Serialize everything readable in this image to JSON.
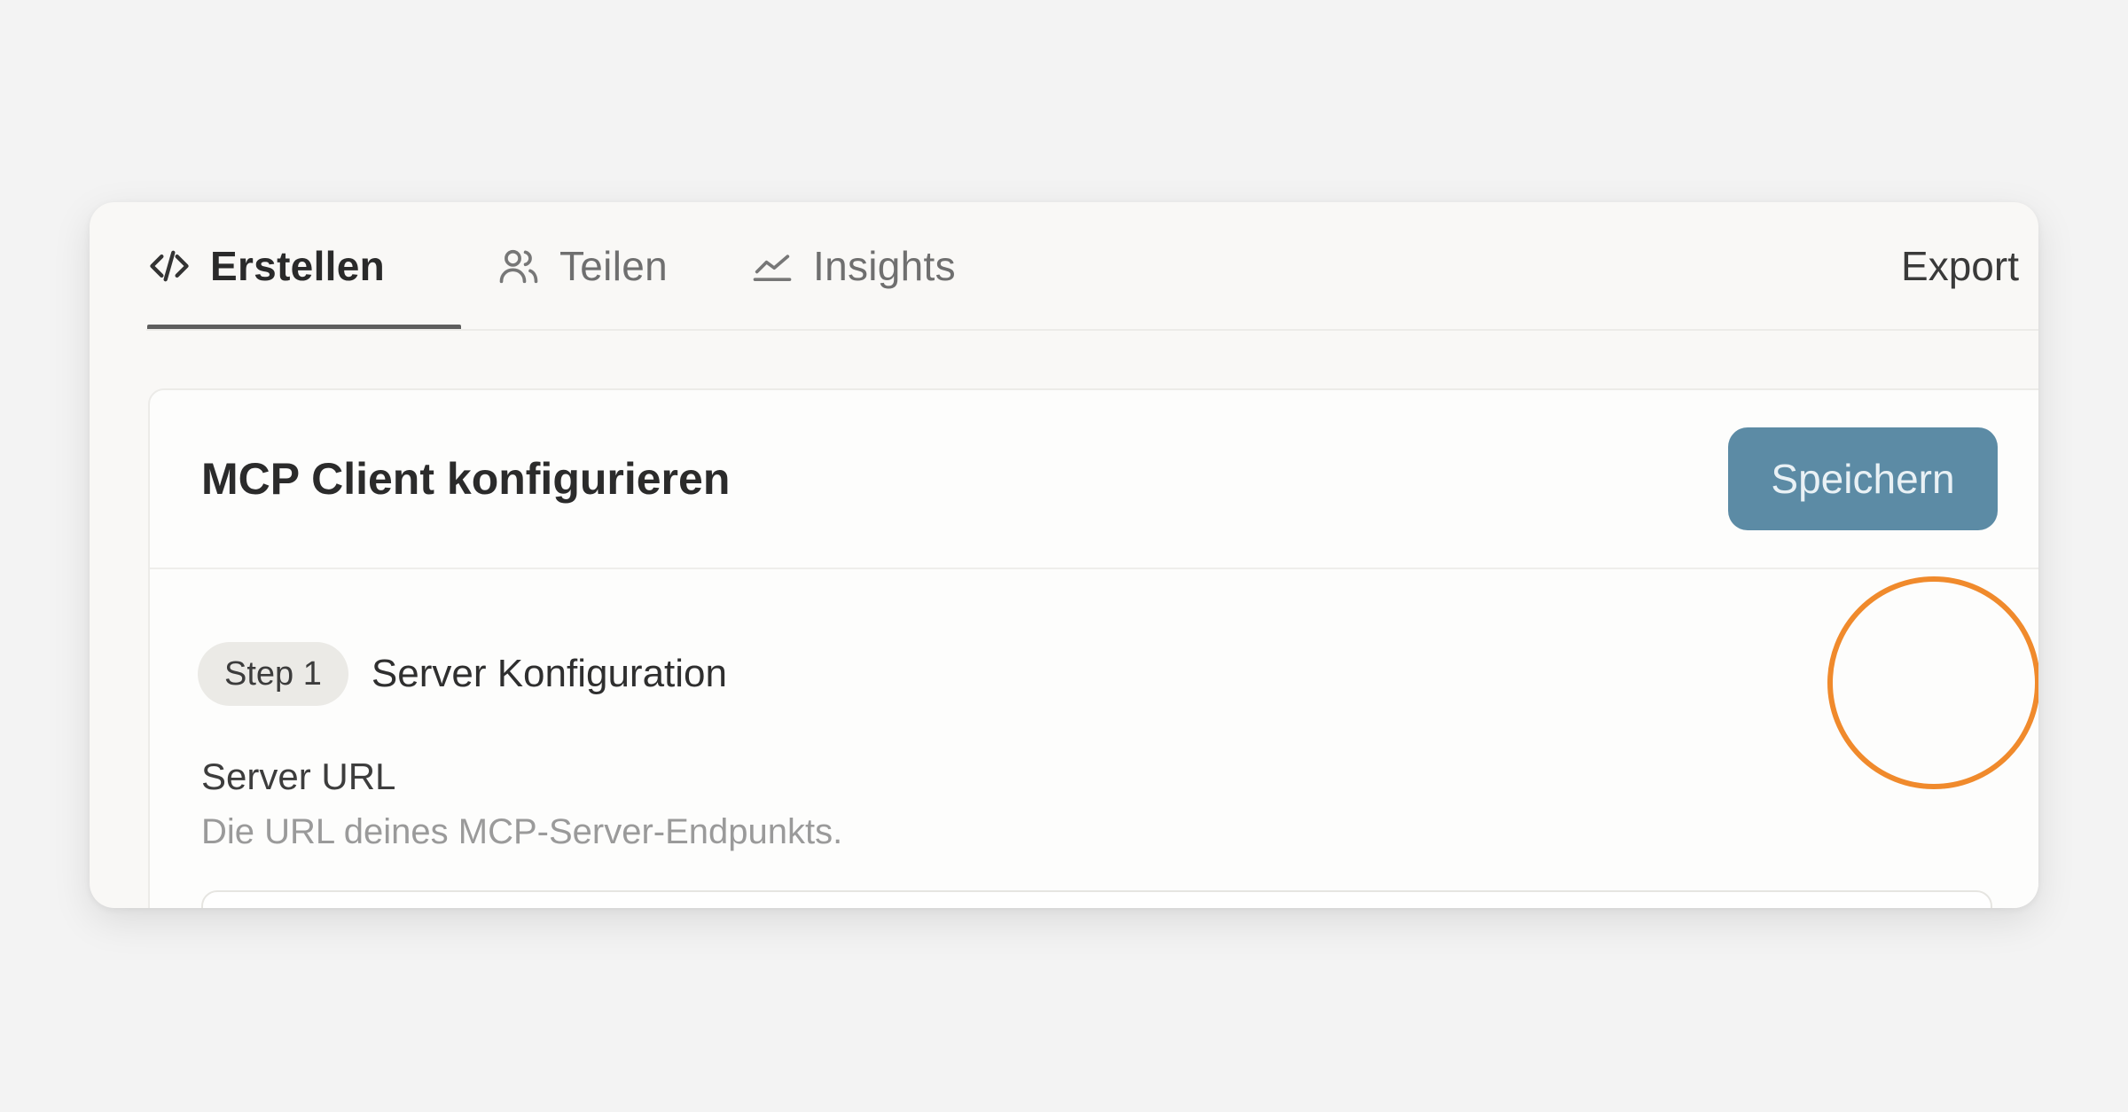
{
  "tabs": [
    {
      "label": "Erstellen",
      "icon": "code-icon",
      "active": true
    },
    {
      "label": "Teilen",
      "icon": "users-icon",
      "active": false
    },
    {
      "label": "Insights",
      "icon": "chart-line-icon",
      "active": false
    }
  ],
  "header": {
    "export_label": "Export"
  },
  "card": {
    "title": "MCP Client konfigurieren",
    "save_label": "Speichern"
  },
  "step": {
    "badge": "Step 1",
    "title": "Server Konfiguration"
  },
  "server_url": {
    "label": "Server URL",
    "help": "Die URL deines MCP-Server-Endpunkts.",
    "value": ""
  },
  "colors": {
    "accent": "#5c8ba5",
    "highlight": "#f08a2c"
  }
}
